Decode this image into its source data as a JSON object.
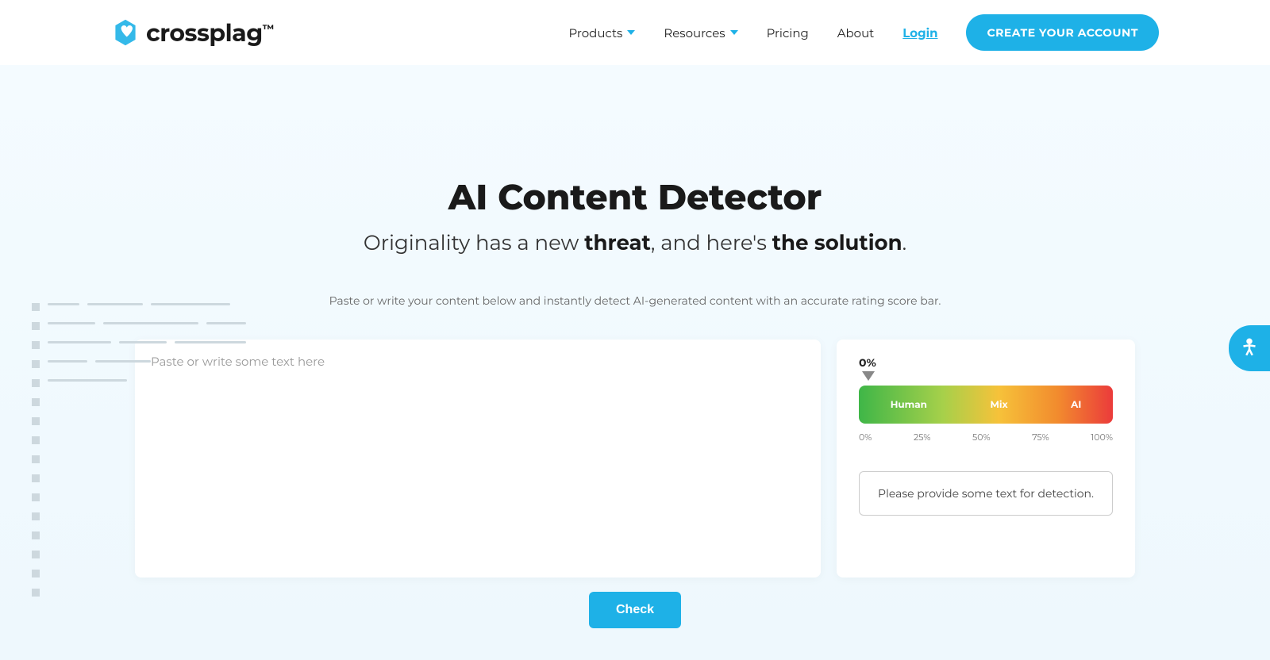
{
  "brand": {
    "name": "crossplag",
    "tm": "™"
  },
  "nav": {
    "products": "Products",
    "resources": "Resources",
    "pricing": "Pricing",
    "about": "About",
    "login": "Login",
    "cta": "CREATE YOUR ACCOUNT"
  },
  "hero": {
    "title": "AI Content Detector",
    "sub_pre": "Originality has a new ",
    "sub_b1": "threat",
    "sub_mid": ", and here's ",
    "sub_b2": "the solution",
    "sub_post": ".",
    "instruction": "Paste or write your content below and instantly detect AI-generated content with an accurate rating score bar."
  },
  "input": {
    "placeholder": "Paste or write some text here",
    "value": ""
  },
  "result": {
    "pointer_value": "0%",
    "labels": {
      "human": "Human",
      "mix": "Mix",
      "ai": "AI"
    },
    "ticks": [
      "0%",
      "25%",
      "50%",
      "75%",
      "100%"
    ],
    "message": "Please provide some text for detection."
  },
  "actions": {
    "check": "Check"
  },
  "a11y": {
    "label": "Accessibility options"
  }
}
